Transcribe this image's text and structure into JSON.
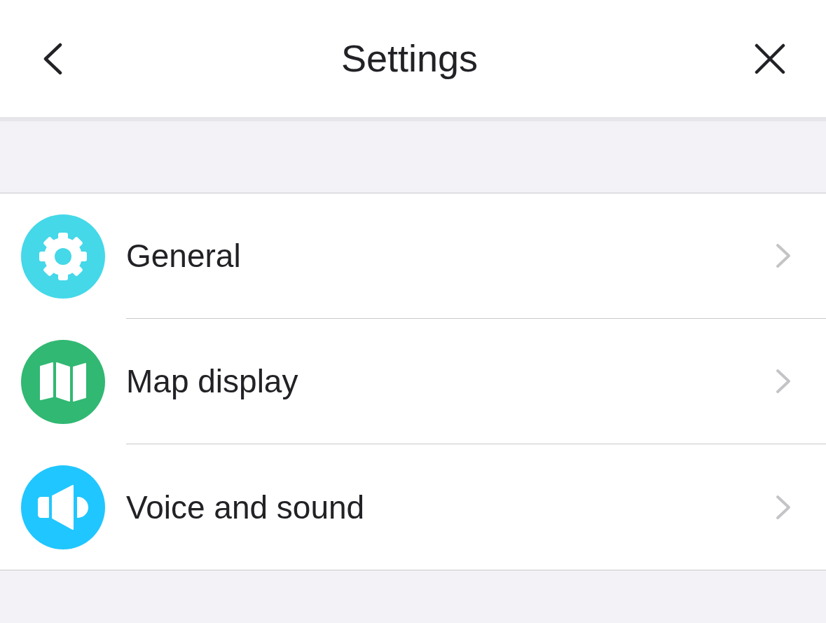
{
  "header": {
    "title": "Settings"
  },
  "items": [
    {
      "label": "General",
      "color": "#44d8e9"
    },
    {
      "label": "Map display",
      "color": "#31b872"
    },
    {
      "label": "Voice and sound",
      "color": "#20c6ff"
    }
  ]
}
